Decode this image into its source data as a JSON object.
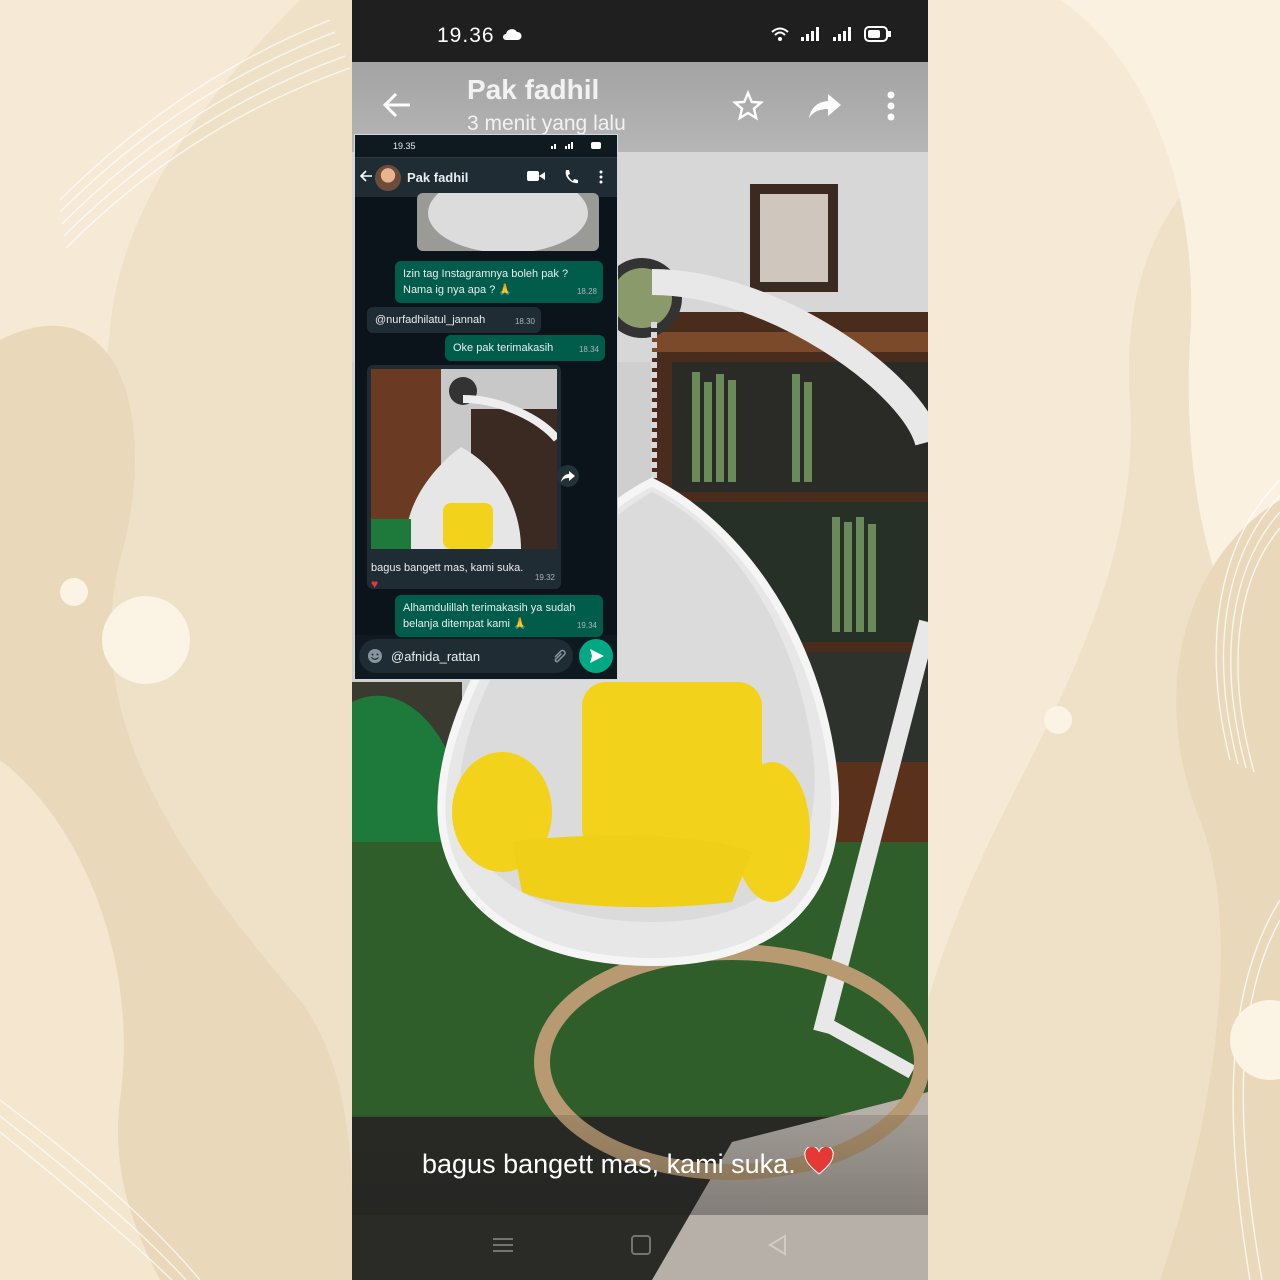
{
  "status": {
    "time": "19.36"
  },
  "header": {
    "title": "Pak fadhil",
    "subtitle": "3 menit yang lalu"
  },
  "chat": {
    "status_time": "19.35",
    "contact": "Pak fadhil",
    "messages": [
      {
        "type": "out",
        "text_line1": "Izin tag Instagramnya boleh pak ?",
        "text_line2": "Nama ig nya apa ? 🙏",
        "time": "18.28"
      },
      {
        "type": "in",
        "text": "@nurfadhilatul_jannah",
        "time": "18.30"
      },
      {
        "type": "out",
        "text": "Oke pak terimakasih",
        "time": "18.34"
      },
      {
        "type": "in",
        "text": "bagus bangett mas, kami suka.",
        "time": "19.32"
      },
      {
        "type": "out",
        "text_line1": "Alhamdulillah terimakasih ya sudah",
        "text_line2": "belanja ditempat kami 🙏",
        "time": "19.34"
      }
    ],
    "input_value": "@afnida_rattan"
  },
  "caption": {
    "text": "bagus bangett mas, kami suka."
  },
  "colors": {
    "whatsapp_green": "#00a884",
    "outgoing": "#005c4b",
    "cushion": "#f2d21a"
  }
}
